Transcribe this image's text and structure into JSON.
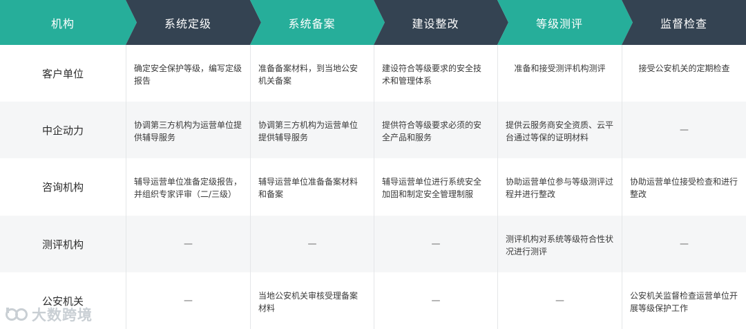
{
  "header": [
    "机构",
    "系统定级",
    "系统备案",
    "建设整改",
    "等级测评",
    "监督检查"
  ],
  "rows": [
    {
      "org": "客户单位",
      "cells": [
        "确定安全保护等级，编写定级报告",
        "准备备案材料，到当地公安机关备案",
        "建设符合等级要求的安全技术和管理体系",
        "准备和接受测评机构测评",
        "接受公安机关的定期检查"
      ]
    },
    {
      "org": "中企动力",
      "cells": [
        "协调第三方机构为运营单位提供辅导服务",
        "协调第三方机构为运营单位提供辅导服务",
        "提供符合等级要求必须的安全产品和服务",
        "提供云服务商安全资质、云平台通过等保的证明材料",
        "—"
      ]
    },
    {
      "org": "咨询机构",
      "cells": [
        "辅导运营单位准备定级报告，并组织专家评审（二/三级）",
        "辅导运营单位准备备案材料和备案",
        "辅导运营单位进行系统安全加固和制定安全管理制服",
        "协助运营单位参与等级测评过程并进行整改",
        "协助运营单位接受检查和进行整改"
      ]
    },
    {
      "org": "测评机构",
      "cells": [
        "—",
        "—",
        "—",
        "测评机构对系统等级符合性状况进行测评",
        "—"
      ]
    },
    {
      "org": "公安机关",
      "cells": [
        "—",
        "当地公安机关审核受理备案材料",
        "—",
        "—",
        "公安机关监督检查运营单位开展等级保护工作"
      ]
    }
  ],
  "colors": {
    "teal": "#26ae9a",
    "navy": "#344352",
    "row_alt": "#f5f6f7",
    "border": "#e4e6e8"
  },
  "watermark": {
    "icon": "logo-icon",
    "text": "大数跨境"
  }
}
